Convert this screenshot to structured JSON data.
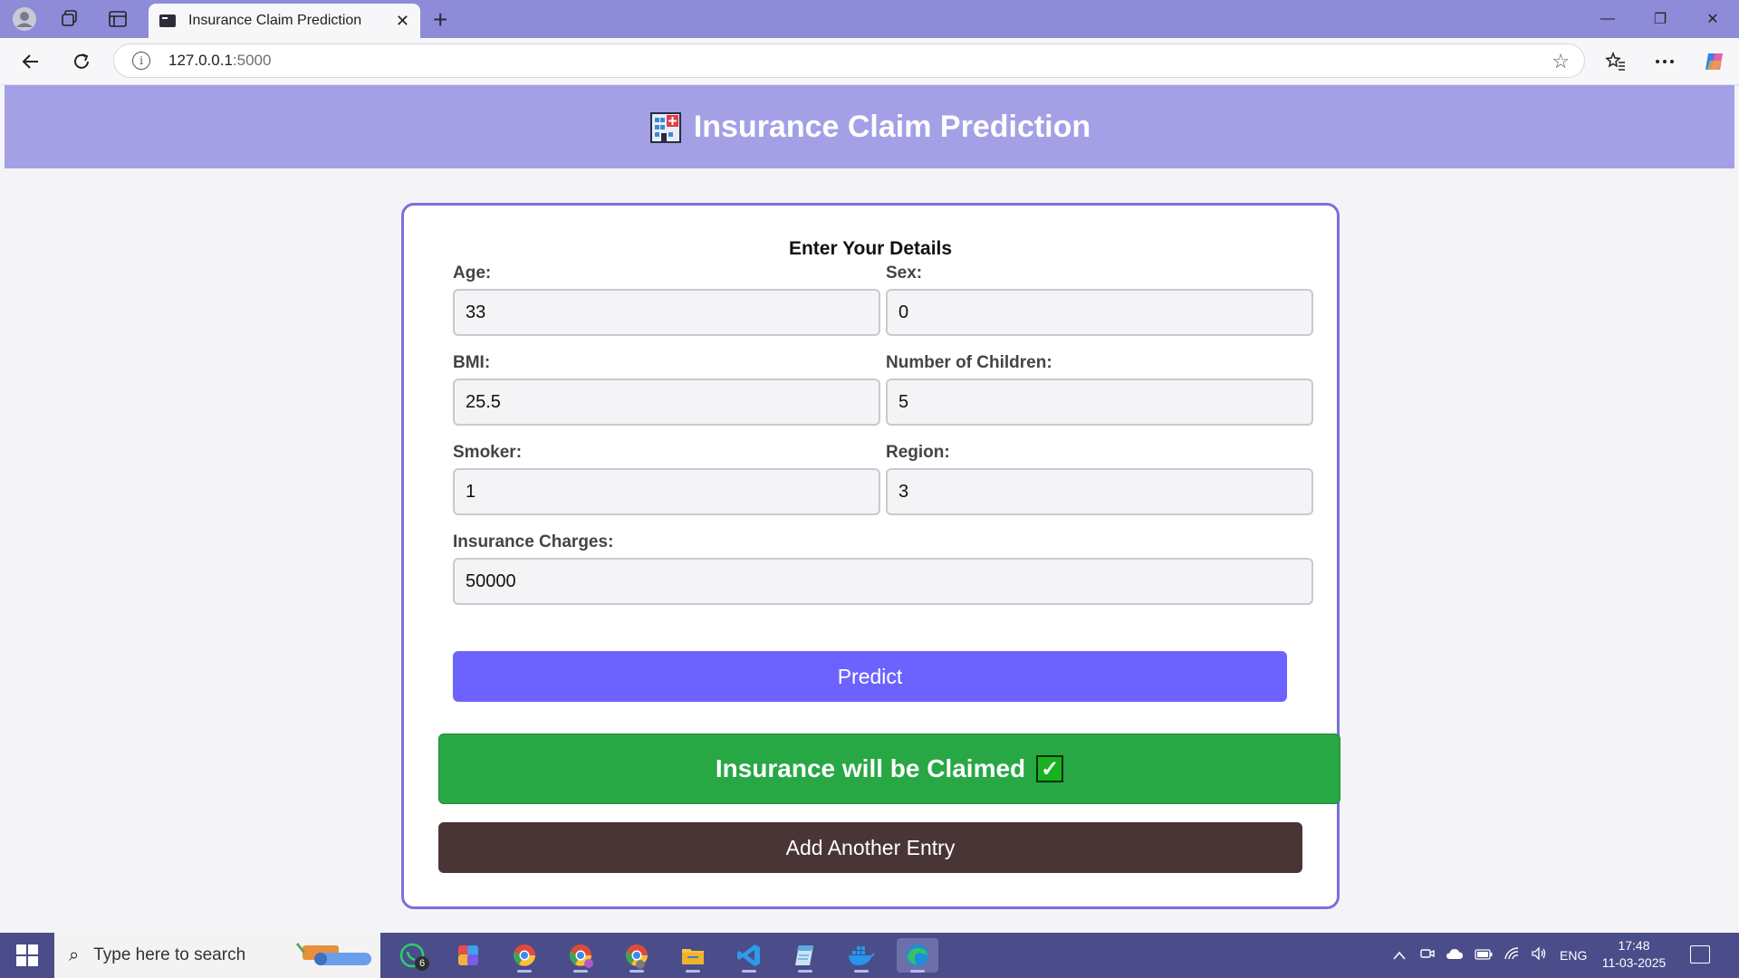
{
  "browser": {
    "tab_title": "Insurance Claim Prediction",
    "tab_close": "✕",
    "new_tab": "+",
    "url_host": "127.0.0.1",
    "url_port": ":5000",
    "window_controls": {
      "minimize": "—",
      "restore": "❐",
      "close": "✕"
    }
  },
  "page": {
    "header_title": "Insurance Claim Prediction",
    "form_heading": "Enter Your Details",
    "fields": {
      "age": {
        "label": "Age:",
        "value": "33"
      },
      "sex": {
        "label": "Sex:",
        "value": "0"
      },
      "bmi": {
        "label": "BMI:",
        "value": "25.5"
      },
      "children": {
        "label": "Number of Children:",
        "value": "5"
      },
      "smoker": {
        "label": "Smoker:",
        "value": "1"
      },
      "region": {
        "label": "Region:",
        "value": "3"
      },
      "charges": {
        "label": "Insurance Charges:",
        "value": "50000"
      }
    },
    "predict_label": "Predict",
    "result_text": "Insurance will be Claimed",
    "result_check": "✓",
    "add_entry_label": "Add Another Entry"
  },
  "taskbar": {
    "search_placeholder": "Type here to search",
    "whatsapp_badge": "6",
    "language": "ENG",
    "time": "17:48",
    "date": "11-03-2025"
  },
  "colors": {
    "header_bg": "#a4a0e6",
    "card_border": "#7b6fe0",
    "predict_bg": "#6c63ff",
    "result_bg": "#28a745",
    "add_entry_bg": "#4a3536",
    "titlebar_bg": "#8e8cd8",
    "taskbar_bg": "#4b4d8a"
  }
}
